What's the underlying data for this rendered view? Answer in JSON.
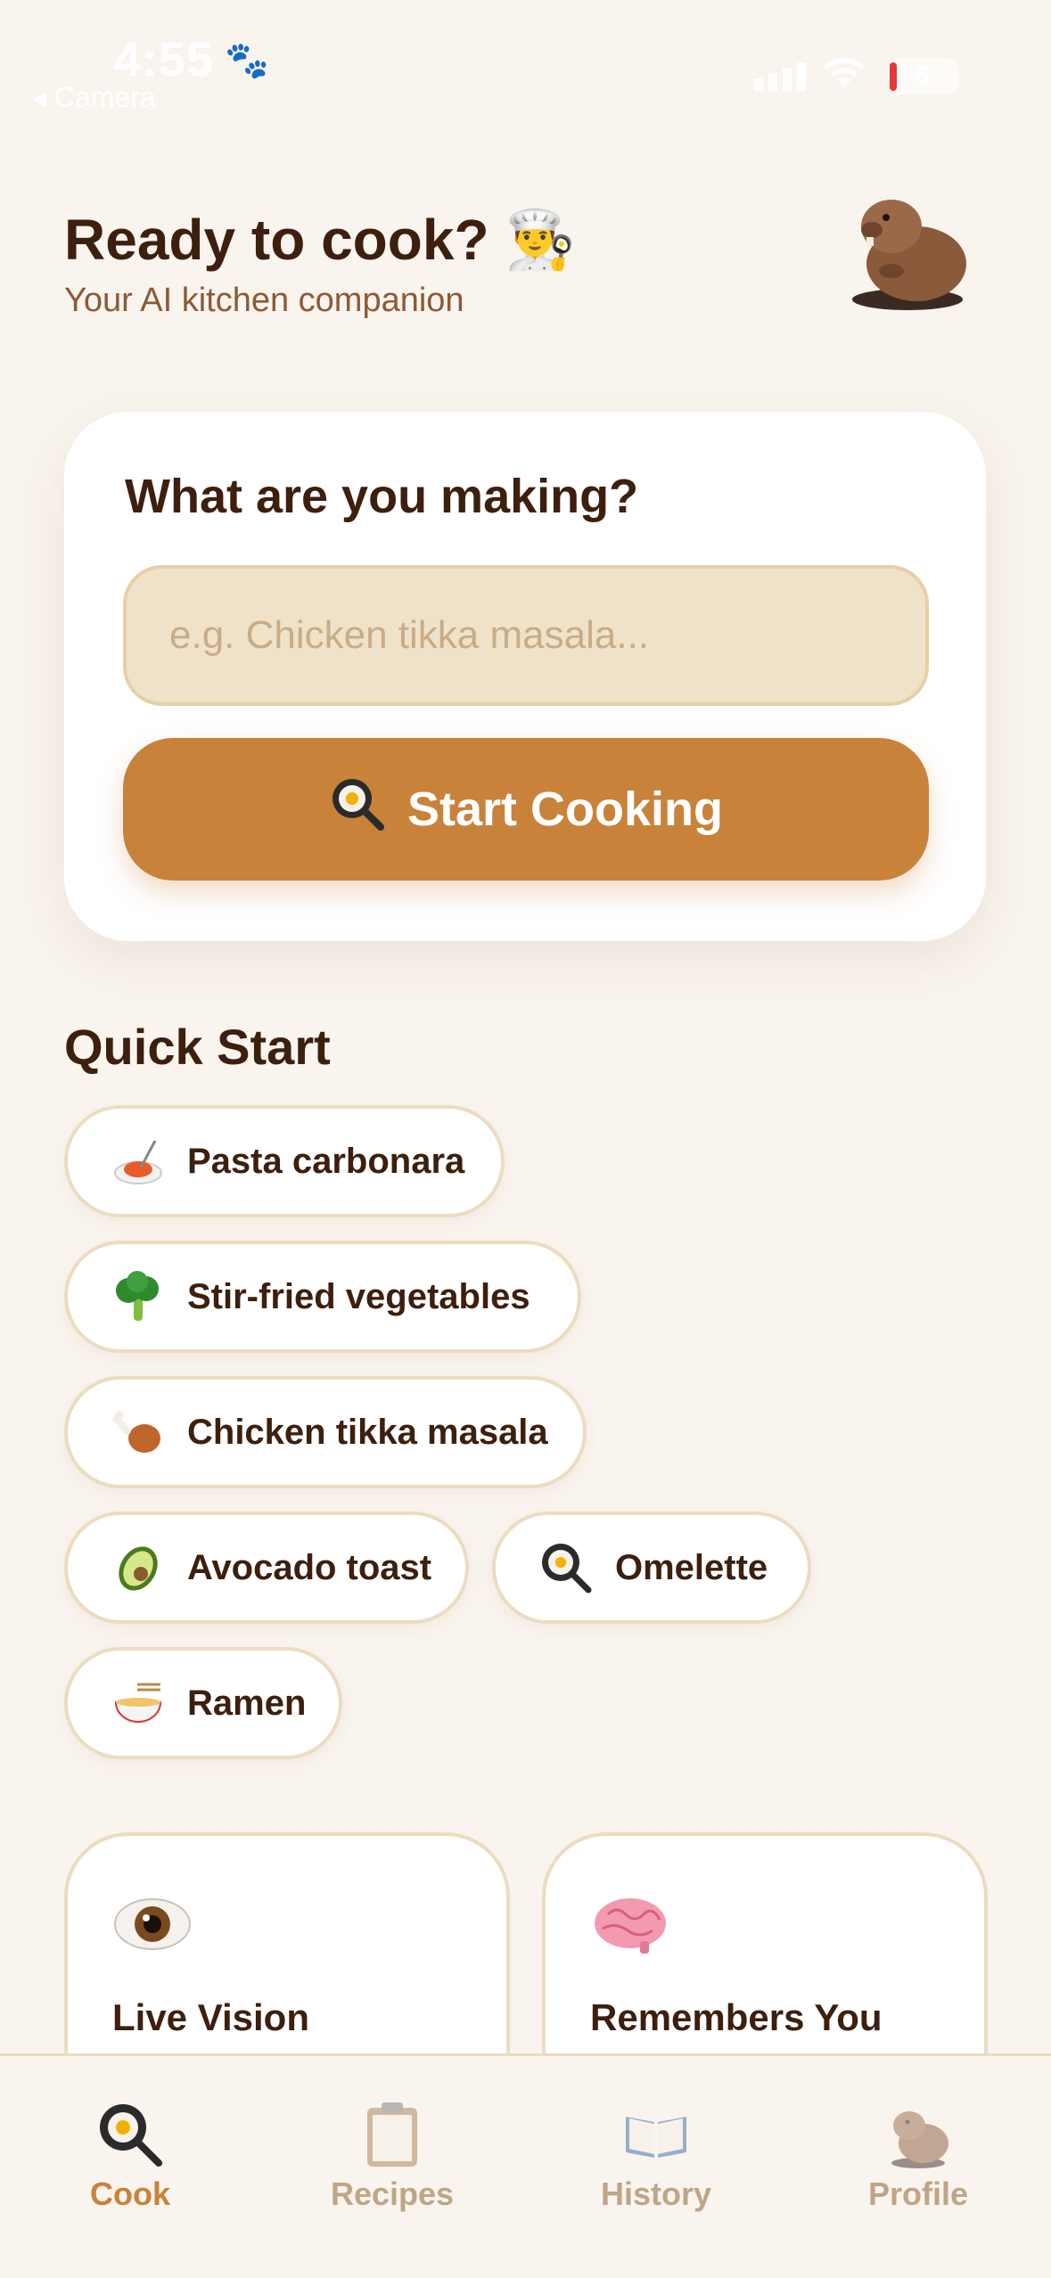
{
  "status_bar": {
    "time": "4:55",
    "back_label": "◂ Camera",
    "battery": "6"
  },
  "header": {
    "title": "Ready to cook? 👨‍🍳",
    "subtitle": "Your AI kitchen companion"
  },
  "card": {
    "title": "What are you making?",
    "input_placeholder": "e.g. Chicken tikka masala...",
    "input_value": "",
    "button_label": "Start Cooking"
  },
  "quick_start": {
    "title": "Quick Start",
    "items": [
      {
        "label": "Pasta carbonara",
        "icon": "spaghetti-icon"
      },
      {
        "label": "Stir-fried vegetables",
        "icon": "broccoli-icon"
      },
      {
        "label": "Chicken tikka masala",
        "icon": "poultry-leg-icon"
      },
      {
        "label": "Avocado toast",
        "icon": "avocado-icon"
      },
      {
        "label": "Omelette",
        "icon": "frying-pan-icon"
      },
      {
        "label": "Ramen",
        "icon": "ramen-bowl-icon"
      }
    ]
  },
  "features": [
    {
      "title": "Live Vision",
      "icon": "eye-icon"
    },
    {
      "title": "Remembers You",
      "icon": "brain-icon"
    }
  ],
  "tabs": [
    {
      "label": "Cook",
      "icon": "frying-pan-icon",
      "active": true
    },
    {
      "label": "Recipes",
      "icon": "clipboard-icon",
      "active": false
    },
    {
      "label": "History",
      "icon": "open-book-icon",
      "active": false
    },
    {
      "label": "Profile",
      "icon": "beaver-icon",
      "active": false
    }
  ],
  "colors": {
    "background": "#f9f4ee",
    "accent": "#c8823a",
    "text_dark": "#3d1f0e",
    "text_muted": "#8b5a35",
    "input_bg": "#f0e2c8",
    "inactive_tab": "#bfa587"
  }
}
